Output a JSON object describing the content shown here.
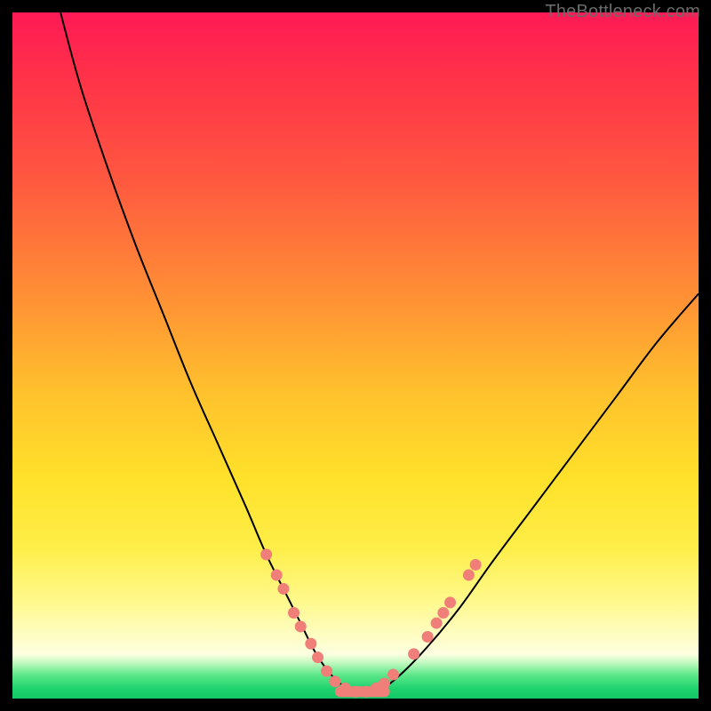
{
  "watermark": "TheBottleneck.com",
  "colors": {
    "frame": "#000000",
    "curve": "#000000",
    "marker_fill": "#ef7f78",
    "marker_stroke": "#d56a63"
  },
  "chart_data": {
    "type": "line",
    "title": "",
    "xlabel": "",
    "ylabel": "",
    "xlim": [
      0,
      100
    ],
    "ylim": [
      0,
      100
    ],
    "series": [
      {
        "name": "bottleneck-curve",
        "x": [
          7,
          10,
          14,
          18,
          22,
          26,
          30,
          34,
          37,
          40,
          42,
          44,
          46,
          48,
          50,
          53,
          56,
          60,
          65,
          70,
          76,
          82,
          88,
          94,
          100
        ],
        "y": [
          100,
          89,
          77,
          66,
          56,
          46,
          37,
          28,
          21,
          15,
          11,
          7,
          4,
          2,
          1,
          1,
          3,
          7,
          13,
          20,
          28,
          36,
          44,
          52,
          59
        ]
      }
    ],
    "markers": {
      "name": "highlighted-points",
      "points": [
        {
          "x": 37.0,
          "y": 21.0
        },
        {
          "x": 38.5,
          "y": 18.0
        },
        {
          "x": 39.5,
          "y": 16.0
        },
        {
          "x": 41.0,
          "y": 12.5
        },
        {
          "x": 42.0,
          "y": 10.5
        },
        {
          "x": 43.5,
          "y": 8.0
        },
        {
          "x": 44.5,
          "y": 6.0
        },
        {
          "x": 45.8,
          "y": 4.0
        },
        {
          "x": 47.0,
          "y": 2.5
        },
        {
          "x": 48.5,
          "y": 1.5
        },
        {
          "x": 50.0,
          "y": 1.0
        },
        {
          "x": 51.5,
          "y": 1.0
        },
        {
          "x": 53.0,
          "y": 1.5
        },
        {
          "x": 54.2,
          "y": 2.2
        },
        {
          "x": 55.5,
          "y": 3.5
        },
        {
          "x": 58.5,
          "y": 6.5
        },
        {
          "x": 60.5,
          "y": 9.0
        },
        {
          "x": 61.8,
          "y": 11.0
        },
        {
          "x": 62.8,
          "y": 12.5
        },
        {
          "x": 63.8,
          "y": 14.0
        },
        {
          "x": 66.5,
          "y": 18.0
        },
        {
          "x": 67.5,
          "y": 19.5
        }
      ]
    },
    "markers_pill": {
      "name": "bottom-pill",
      "x_start": 47.0,
      "x_end": 55.0,
      "y": 1.0
    }
  }
}
